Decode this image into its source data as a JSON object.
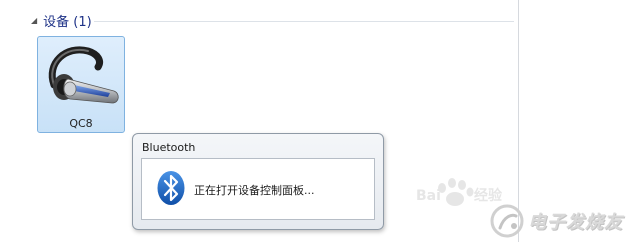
{
  "devices_group": {
    "label": "设备 (1)",
    "toggle_icon": "collapse-triangle-icon",
    "items": [
      {
        "name": "QC8",
        "icon": "bluetooth-headset-icon"
      }
    ]
  },
  "dialog": {
    "title": "Bluetooth",
    "icon": "bluetooth-icon",
    "message": "正在打开设备控制面板..."
  },
  "watermarks": {
    "baidu_logo": "baidu-paw-logo",
    "elecfans_logo": "elecfans-logo",
    "elecfans_text": "电子发烧友"
  },
  "colors": {
    "group_header_text": "#1e3287",
    "tile_selected": "#cfe5f9",
    "tile_border": "#7fb2e0",
    "bluetooth_blue": "#1c6bc7"
  }
}
